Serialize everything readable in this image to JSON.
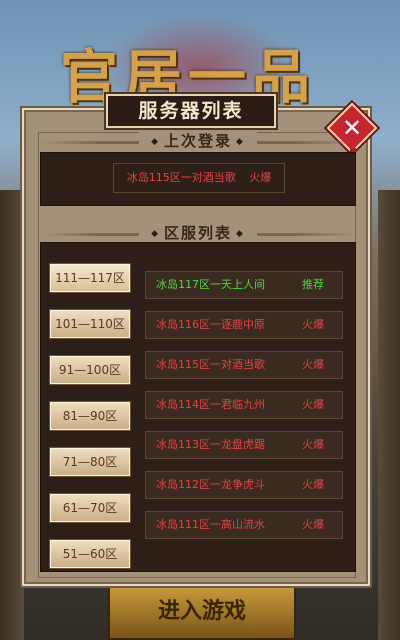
{
  "background": {
    "game_title": "官居一品",
    "enter_button": "进入游戏"
  },
  "dialog": {
    "title": "服务器列表",
    "close_icon": "✕",
    "last_login": {
      "header": "上次登录",
      "server": "冰岛115区一对酒当歌",
      "status": "火爆"
    },
    "zone_list": {
      "header": "区服列表",
      "ranges": [
        "111—117区",
        "101—110区",
        "91—100区",
        "81—90区",
        "71—80区",
        "61—70区",
        "51—60区"
      ],
      "servers": [
        {
          "name": "冰岛117区一天上人间",
          "status": "推荐",
          "color": "#56d24a"
        },
        {
          "name": "冰岛116区一逐鹿中原",
          "status": "火爆",
          "color": "#e4424a"
        },
        {
          "name": "冰岛115区一对酒当歌",
          "status": "火爆",
          "color": "#e4424a"
        },
        {
          "name": "冰岛114区一君临九州",
          "status": "火爆",
          "color": "#e4424a"
        },
        {
          "name": "冰岛113区一龙盘虎踞",
          "status": "火爆",
          "color": "#e4424a"
        },
        {
          "name": "冰岛112区一龙争虎斗",
          "status": "火爆",
          "color": "#e4424a"
        },
        {
          "name": "冰岛111区一高山流水",
          "status": "火爆",
          "color": "#e4424a"
        }
      ]
    }
  },
  "colors": {
    "hot": "#e4424a",
    "recommended": "#56d24a",
    "panel": "#a4917a",
    "dark_panel": "#2d1f17"
  }
}
